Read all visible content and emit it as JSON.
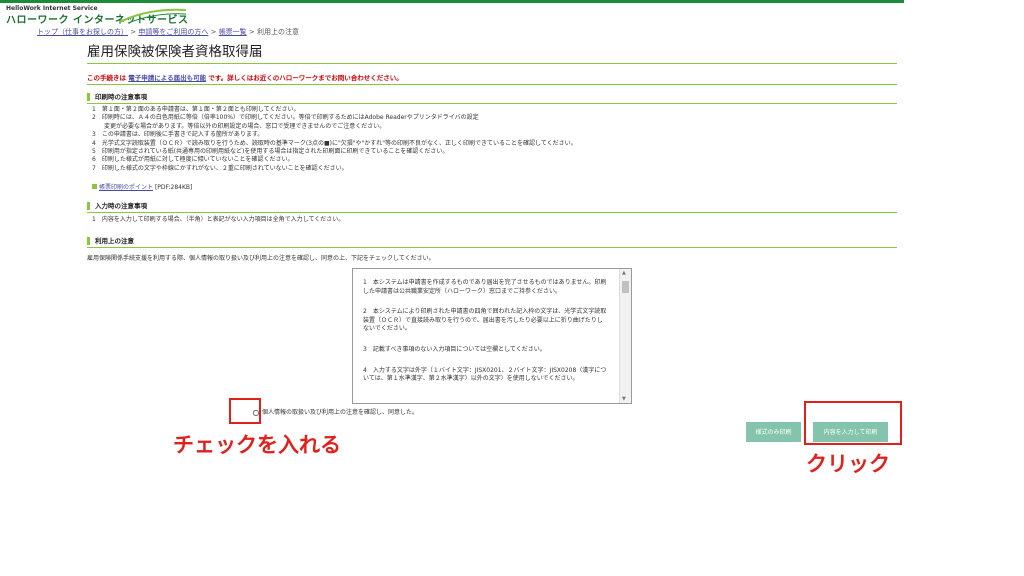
{
  "header": {
    "logo_en": "HelloWork Internet Service",
    "logo_ja": "ハローワーク インターネットサービス"
  },
  "breadcrumb": {
    "item1": "トップ（仕事をお探しの方）",
    "item2": "申請等をご利用の方へ",
    "item3": "帳票一覧",
    "current": "利用上の注意",
    "sep": ">"
  },
  "page_title": "雇用保険被保険者資格取得届",
  "notice": {
    "prefix": "この手続きは",
    "link": "電子申請による届出も可能",
    "suffix": "です。詳しくはお近くのハローワークまでお問い合わせください。"
  },
  "print_section": {
    "heading": "印刷時の注意事項",
    "items": [
      "1　第１面・第２面のある申請書は、第１面・第２面とも印刷してください。",
      "2　印刷時には、Ａ４の白色用紙に等倍（倍率100%）で印刷してください。等倍で印刷するためにはAdobe Readerやプリンタドライバの設定",
      "変更が必要な場合があります。等倍以外の印刷設定の場合、窓口で受理できませんのでご注意ください。",
      "3　この申請書は、印刷後に手書きで記入する箇所があります。",
      "4　光学式文字読取装置（ＯＣＲ）で読み取りを行うため、読取時の基準マーク(3点の■)に\"欠損\"や\"かすれ\"等の印刷不良がなく、正しく印刷できていることを確認してください。",
      "5　印刷用が指定されている紙(共通専用の印刷用紙など)を使用する場合は指定された印刷面に印刷できていることを確認ください。",
      "6　印刷した様式が用紙に対して極度に傾いていないことを確認ください。",
      "7　印刷した様式の文字や枠線にかすれがない、２重に印刷されていないことを確認ください。"
    ],
    "link_label": "帳票印刷のポイント",
    "link_suffix": "[PDF:284KB]"
  },
  "input_section": {
    "heading": "入力時の注意事項",
    "items": [
      "1　内容を入力して印刷する場合、（半角）と表記がない入力項目は全角で入力してください。"
    ]
  },
  "usage_section": {
    "heading": "利用上の注意",
    "intro": "雇用保険関係手続支援を利用する際、個人情報の取り扱い及び利用上の注意を確認し、同意の上、下記をチェックしてください。"
  },
  "terms": [
    "1　本システムは申請書を作成するものであり届出を完了させるものではありません。印刷した申請書は公共職業安定所（ハローワーク）窓口までご持参ください。",
    "2　本システムにより印刷された申請書の四角で囲われた記入枠の文字は、光学式文字読取装置（ＯＣＲ）で直接読み取りを行うので、届出書を汚したり必要以上に折り曲げたりしないでください。",
    "3　記載すべき事項のない入力項目については空欄としてください。",
    "4　入力する文字は外字（１バイト文字：JISX0201、２バイト文字：JISX0208（漢字については、第１水準漢字、第２水準漢字）以外の文字）を使用しないでください。"
  ],
  "agree_label": "個人情報の取扱い及び利用上の注意を確認し、同意した。",
  "buttons": {
    "layout_only": "様式のみ印刷",
    "input_print": "内容を入力して印刷"
  },
  "annotations": {
    "check": "チェックを入れる",
    "click": "クリック",
    "color": "#e0201a"
  },
  "colors": {
    "accent_green": "#8cc63f",
    "top_bar": "#1d8a3a",
    "button": "#84c4ad"
  }
}
